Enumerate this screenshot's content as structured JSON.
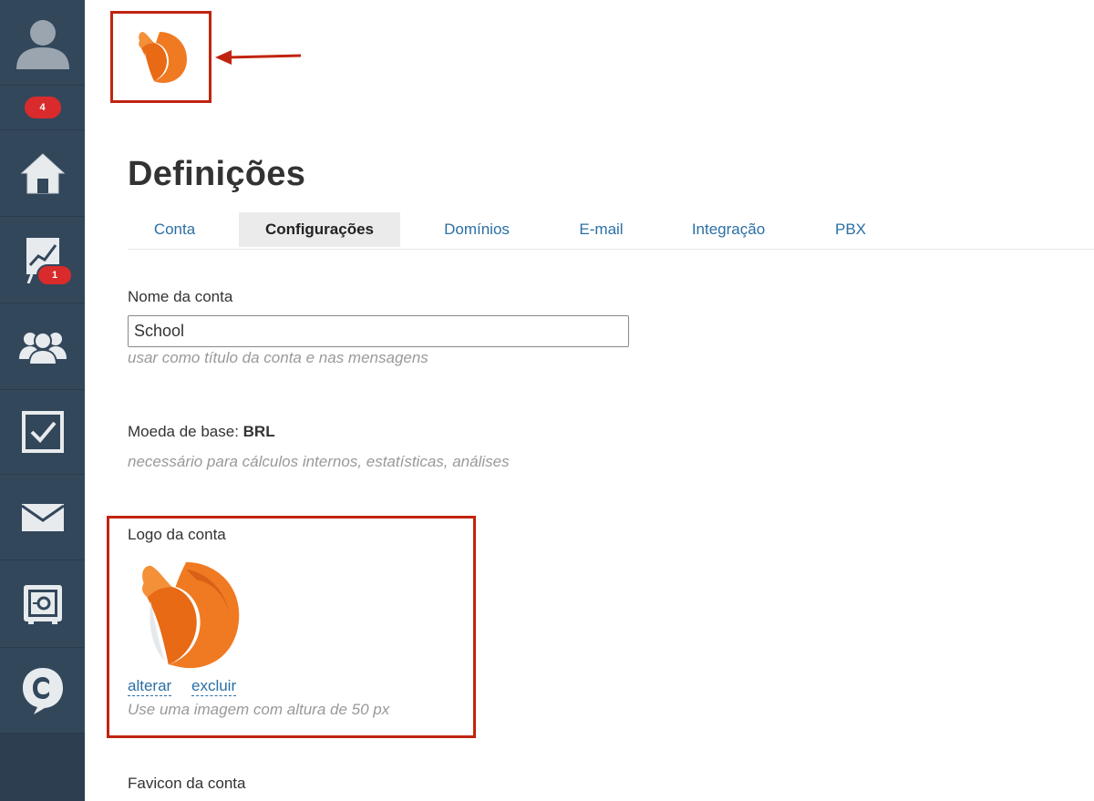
{
  "sidebar": {
    "notifications_badge": "4",
    "crm_badge": "1",
    "items": [
      {
        "name": "home"
      },
      {
        "name": "crm"
      },
      {
        "name": "contacts"
      },
      {
        "name": "tasks"
      },
      {
        "name": "mail"
      },
      {
        "name": "settings"
      },
      {
        "name": "talk"
      }
    ]
  },
  "page": {
    "title": "Definições"
  },
  "tabs": [
    {
      "label": "Conta"
    },
    {
      "label": "Configurações",
      "active": true
    },
    {
      "label": "Domínios"
    },
    {
      "label": "E-mail"
    },
    {
      "label": "Integração"
    },
    {
      "label": "PBX"
    }
  ],
  "form": {
    "account_name_label": "Nome da conta",
    "account_name_value": "School",
    "account_name_hint": "usar como título da conta e nas mensagens",
    "currency_label": "Moeda de base:",
    "currency_value": "BRL",
    "currency_hint": "necessário para cálculos internos, estatísticas, análises",
    "logo_label": "Logo da conta",
    "logo_change": "alterar",
    "logo_delete": "excluir",
    "logo_hint": "Use uma imagem com altura de 50 px",
    "favicon_label": "Favicon da conta"
  },
  "colors": {
    "sidebar_bg": "#33475b",
    "highlight_red": "#c0240f",
    "link_blue": "#2a6fa5",
    "badge_red": "#d92b2b",
    "logo_orange": "#f07a22"
  }
}
